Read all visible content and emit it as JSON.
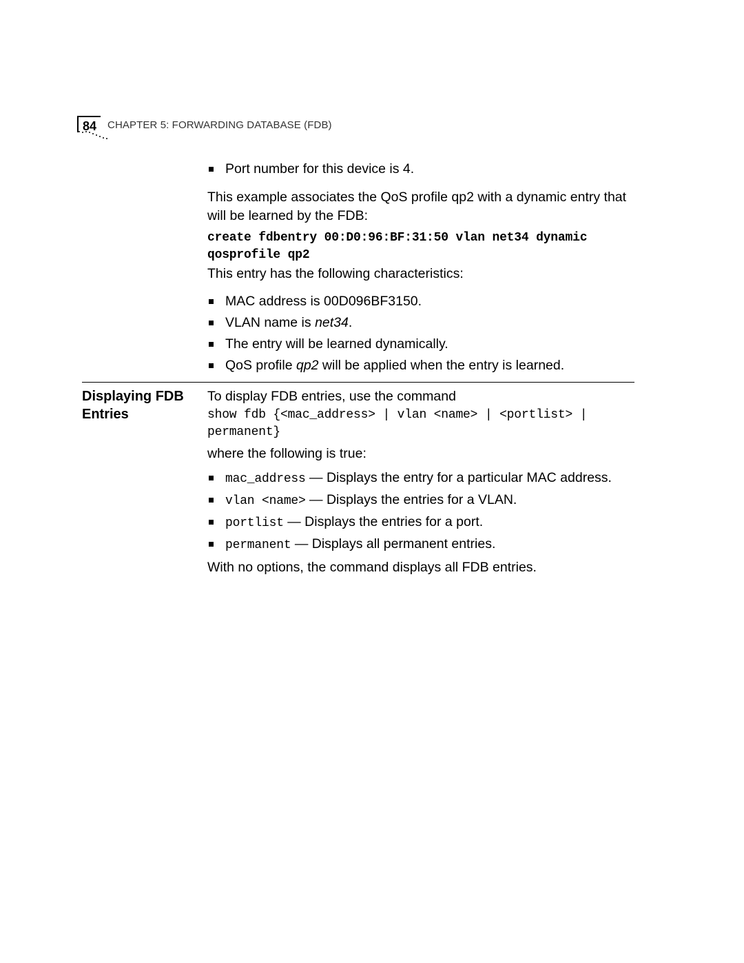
{
  "header": {
    "page_number": "84",
    "chapter_prefix": "C",
    "chapter_word_tail": "HAPTER",
    "chapter_num": " 5: ",
    "title_prefix": "F",
    "title_word_1_tail": "ORWARDING",
    "title_word_2_prefix": " D",
    "title_word_2_tail": "ATABASE",
    "title_paren": " (FDB)"
  },
  "top_bullet": "Port number for this device is 4.",
  "para1": "This example associates the QoS profile qp2 with a dynamic entry that will be learned by the FDB:",
  "cmd1": "create fdbentry 00:D0:96:BF:31:50 vlan net34 dynamic qosprofile qp2",
  "para2": "This entry has the following characteristics:",
  "char_list": {
    "i1": "MAC address is 00D096BF3150.",
    "i2_a": "VLAN name is ",
    "i2_b": "net34",
    "i2_c": ".",
    "i3": "The entry will be learned dynamically.",
    "i4_a": "QoS profile ",
    "i4_b": "qp2",
    "i4_c": " will be applied when the entry is learned."
  },
  "section2": {
    "heading_l1": "Displaying FDB",
    "heading_l2": "Entries",
    "intro": "To display FDB entries, use the command",
    "cmd": "show fdb {<mac_address> | vlan <name> | <portlist> | permanent}",
    "where": "where the following is true:",
    "opts": {
      "o1_code": "mac_address",
      "o1_text": " — Displays the entry for a particular MAC address.",
      "o2_code": "vlan <name>",
      "o2_text": " — Displays the entries for a VLAN.",
      "o3_code": "portlist",
      "o3_text": " — Displays the entries for a port.",
      "o4_code": "permanent",
      "o4_text": " — Displays all permanent entries."
    },
    "outro": "With no options, the command displays all FDB entries."
  }
}
